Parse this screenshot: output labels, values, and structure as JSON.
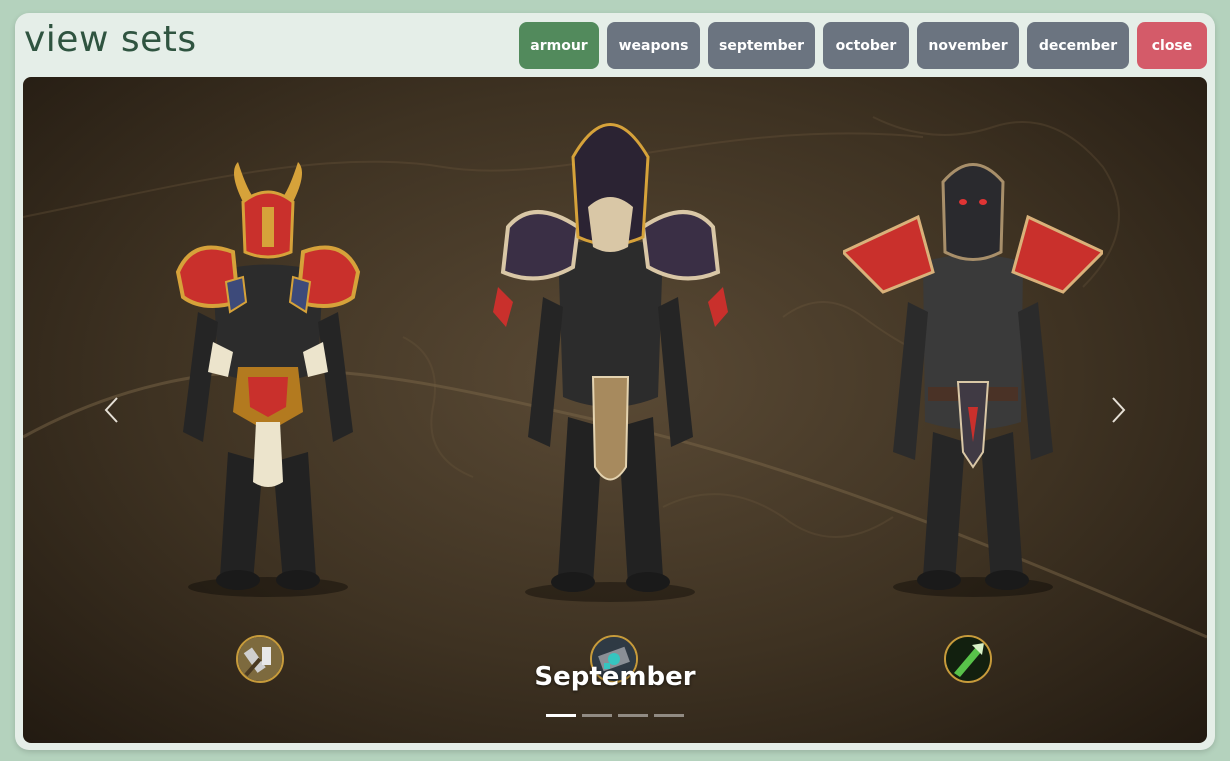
{
  "header": {
    "title": "view sets"
  },
  "tabs": [
    {
      "label": "armour",
      "state": "active"
    },
    {
      "label": "weapons",
      "state": "default"
    },
    {
      "label": "september",
      "state": "default"
    },
    {
      "label": "october",
      "state": "default"
    },
    {
      "label": "november",
      "state": "default"
    },
    {
      "label": "december",
      "state": "default"
    },
    {
      "label": "close",
      "state": "close"
    }
  ],
  "colors": {
    "active_tab": "#528a5c",
    "default_tab": "#6b7480",
    "close_tab": "#d45b69",
    "title": "#2f5440",
    "page_bg": "#b4d2bd",
    "panel_bg": "#e5eee8"
  },
  "carousel": {
    "caption": "September",
    "slide_count": 4,
    "active_slide": 1,
    "prev_icon": "chevron-left-icon",
    "next_icon": "chevron-right-icon",
    "sets": [
      {
        "armor_style": "plate red-gold",
        "class_icon": "mace-icon"
      },
      {
        "armor_style": "cloth violet-silver",
        "class_icon": "engineering-icon"
      },
      {
        "armor_style": "leather red-dark",
        "class_icon": "green-blade-icon"
      }
    ]
  }
}
